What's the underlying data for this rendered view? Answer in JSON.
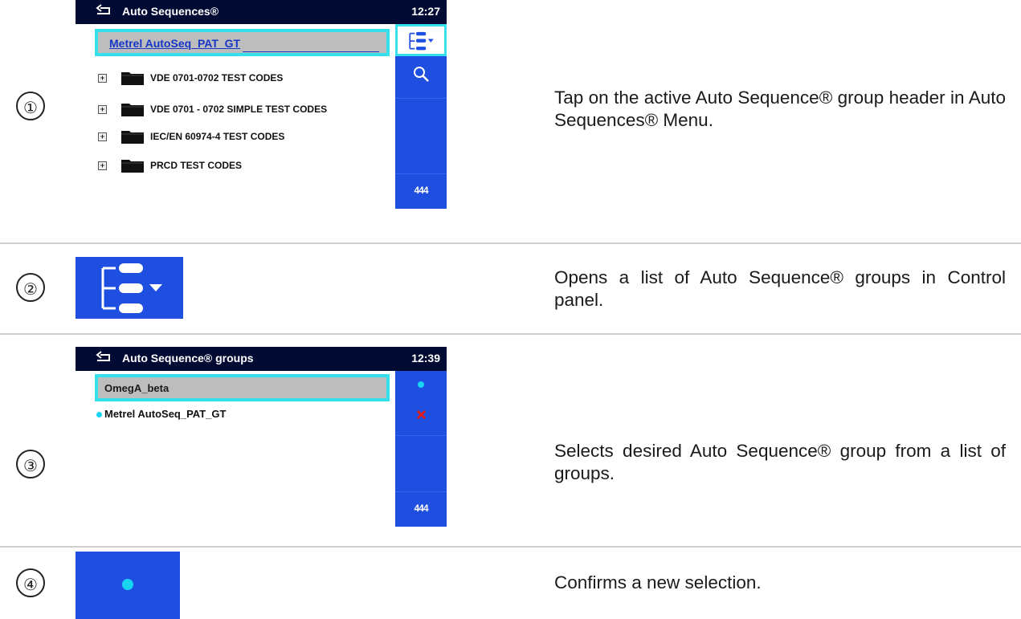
{
  "rows": [
    {
      "number": "①",
      "description": "Tap on the active Auto Sequence® group header in Auto Sequences® Menu.",
      "screen": {
        "title": "Auto Sequences®",
        "time": "12:27",
        "active_group": "Metrel AutoSeq_PAT_GT",
        "folders": [
          "VDE 0701-0702 TEST CODES",
          "VDE 0701 - 0702 SIMPLE TEST CODES",
          "IEC/EN 60974-4 TEST CODES",
          "PRCD TEST CODES"
        ],
        "panel_icons": [
          "group-list-icon",
          "search-icon"
        ],
        "more": "444"
      }
    },
    {
      "number": "②",
      "description": "Opens a list of Auto Sequence® groups in Control panel.",
      "icon": "group-list-icon"
    },
    {
      "number": "③",
      "description": "Selects desired Auto Sequence® group from a list of groups.",
      "screen": {
        "title": "Auto Sequence® groups",
        "time": "12:39",
        "selected_item": "OmegA_beta",
        "items": [
          "Metrel AutoSeq_PAT_GT"
        ],
        "panel_icons": [
          "confirm-dot-icon",
          "delete-icon"
        ],
        "more": "444"
      }
    },
    {
      "number": "④",
      "description": "Confirms a new selection.",
      "icon": "confirm-dot-icon"
    }
  ],
  "colors": {
    "title_bar": "#000a33",
    "panel_blue": "#1f4fe0",
    "highlight_border": "#35e0ea",
    "cyan_dot": "#19d3f3",
    "delete_red": "#e21b1b",
    "header_gray": "#bdbdbd"
  }
}
